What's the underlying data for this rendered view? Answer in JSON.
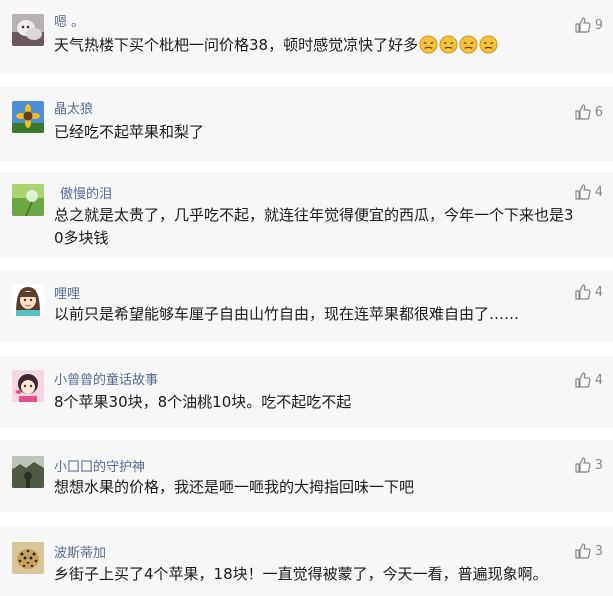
{
  "comments": [
    {
      "name": "嗯 。",
      "text": "天气热楼下买个枇杷一问价格38，顿时感觉凉快了好多",
      "likes": "9",
      "emoji_count": 4,
      "avatar": "cat-avatar"
    },
    {
      "name": "晶太狼",
      "text": "已经吃不起苹果和梨了",
      "likes": "6",
      "avatar": "sunflower-avatar"
    },
    {
      "name": "傲慢的泪",
      "text": "总之就是太贵了，几乎吃不起，就连往年觉得便宜的西瓜，今年一个下来也是30多块钱",
      "likes": "4",
      "avatar": "dandelion-avatar"
    },
    {
      "name": "哩哩",
      "text": "以前只是希望能够车厘子自由山竹自由，现在连苹果都很难自由了……",
      "likes": "4",
      "avatar": "cartoon-girl-avatar"
    },
    {
      "name": "小曾曾的童话故事",
      "text": "8个苹果30块，8个油桃10块。吃不起吃不起",
      "likes": "4",
      "avatar": "pink-cartoon-avatar"
    },
    {
      "name": "小囗囗的守护神",
      "text": "想想水果的价格，我还是咂一咂我的大拇指回味一下吧",
      "likes": "3",
      "avatar": "landscape-avatar"
    },
    {
      "name": "波斯蒂加",
      "text": "乡街子上买了4个苹果，18块！一直觉得被蒙了，今天一看，普遍现象啊。",
      "likes": "3",
      "avatar": "leopard-avatar"
    }
  ],
  "colors": {
    "name": "#576b95",
    "text": "#1a1a1a",
    "likes": "#888888",
    "card_bg": "#f7f7f7"
  }
}
